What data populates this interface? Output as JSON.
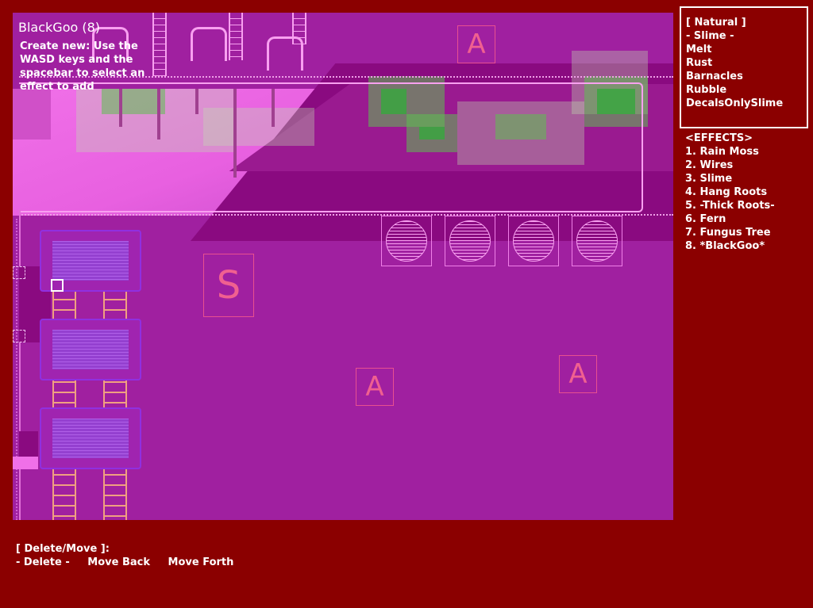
{
  "hud": {
    "title": "BlackGoo (8)",
    "hint": "Create new: Use the WASD keys and the spacebar to select an effect to add"
  },
  "categories": {
    "header": "[ Natural ]",
    "items": [
      "- Slime -",
      "Melt",
      "Rust",
      "Barnacles",
      "Rubble",
      "DecalsOnlySlime"
    ]
  },
  "effects": {
    "header": "<EFFECTS>",
    "items": [
      "1. Rain Moss",
      "2. Wires",
      "3. Slime",
      "4. Hang Roots",
      "5. -Thick Roots-",
      "6. Fern",
      "7. Fungus Tree",
      "8. *BlackGoo*"
    ]
  },
  "bottom": {
    "header": "[ Delete/Move ]:",
    "delete_label": "- Delete -",
    "move_back_label": "Move Back",
    "move_forth_label": "Move Forth"
  },
  "markers": {
    "a": "A",
    "s": "S"
  },
  "colors": {
    "background": "#8b0000",
    "level_fill": "#a020a0",
    "moss": "#3aa640",
    "ui_text": "#ffffff"
  }
}
